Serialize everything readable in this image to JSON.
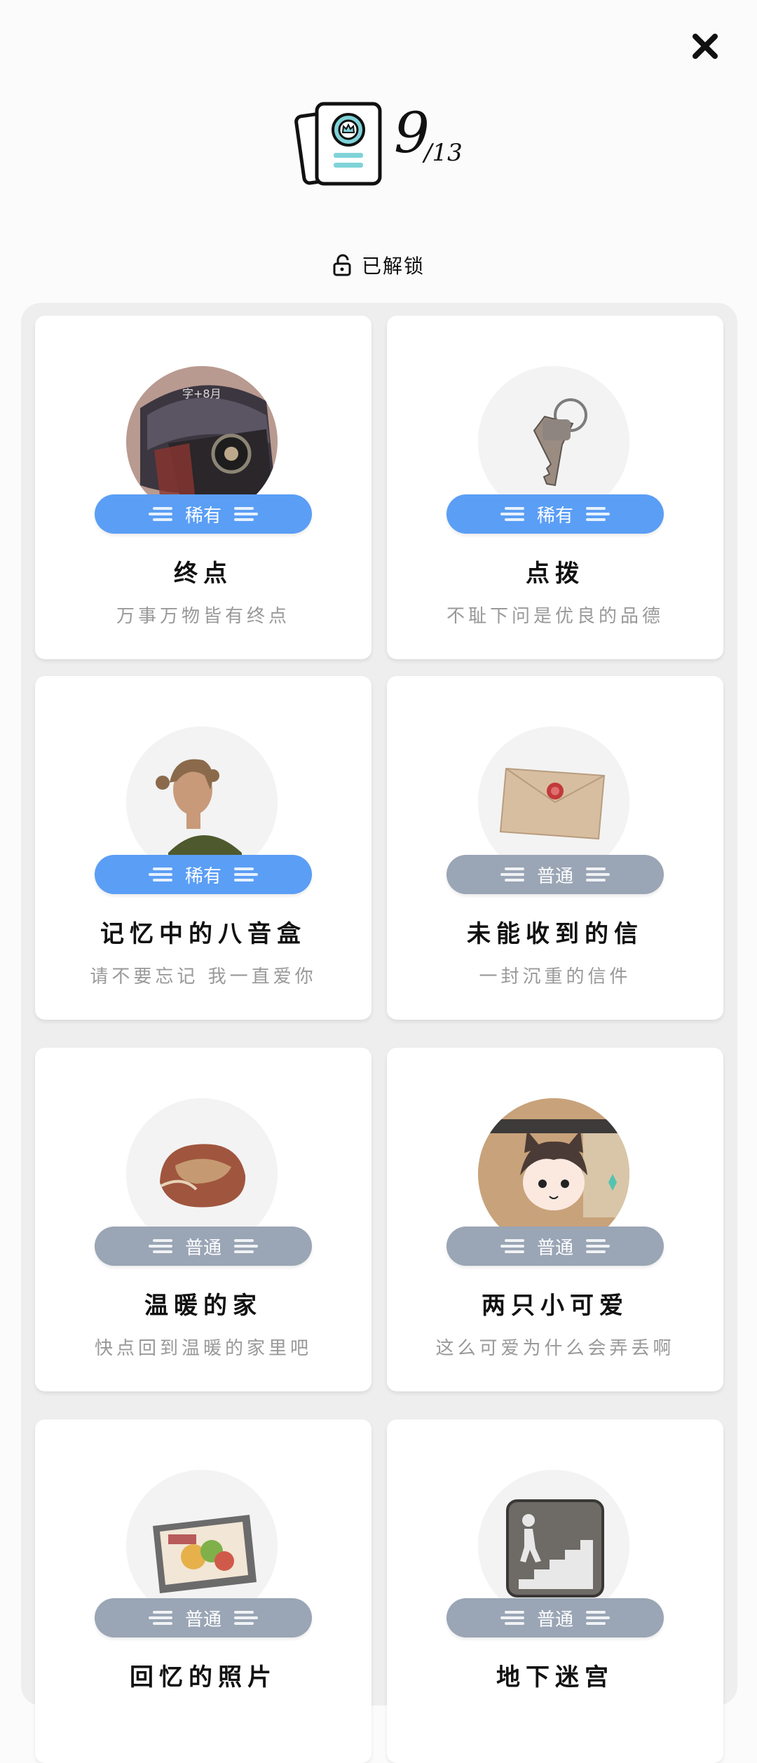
{
  "header": {
    "close_icon": "close-icon",
    "collection_icon": "card-collection-icon",
    "unlocked_count": "9",
    "total_count": "/13"
  },
  "section": {
    "label": "已解锁",
    "icon": "unlock-icon"
  },
  "items": [
    {
      "name": "终点",
      "desc": "万事万物皆有终点",
      "rarity": "稀有",
      "rarity_type": "rare",
      "image": "cap-image"
    },
    {
      "name": "点拨",
      "desc": "不耻下问是优良的品德",
      "rarity": "稀有",
      "rarity_type": "rare",
      "image": "key-image"
    },
    {
      "name": "记忆中的八音盒",
      "desc": "请不要忘记 我一直爱你",
      "rarity": "稀有",
      "rarity_type": "rare",
      "image": "woman-portrait-image"
    },
    {
      "name": "未能收到的信",
      "desc": "一封沉重的信件",
      "rarity": "普通",
      "rarity_type": "common",
      "image": "envelope-image"
    },
    {
      "name": "温暖的家",
      "desc": "快点回到温暖的家里吧",
      "rarity": "普通",
      "rarity_type": "common",
      "image": "bread-image"
    },
    {
      "name": "两只小可爱",
      "desc": "这么可爱为什么会弄丢啊",
      "rarity": "普通",
      "rarity_type": "common",
      "image": "cat-boy-image"
    },
    {
      "name": "回忆的照片",
      "desc": "",
      "rarity": "普通",
      "rarity_type": "common",
      "image": "photo-image"
    },
    {
      "name": "地下迷宫",
      "desc": "",
      "rarity": "普通",
      "rarity_type": "common",
      "image": "stairs-sign-image"
    }
  ],
  "colors": {
    "rare": "#5b9ef5",
    "common": "#9aa5b5",
    "accent_teal": "#7fd3d8"
  }
}
